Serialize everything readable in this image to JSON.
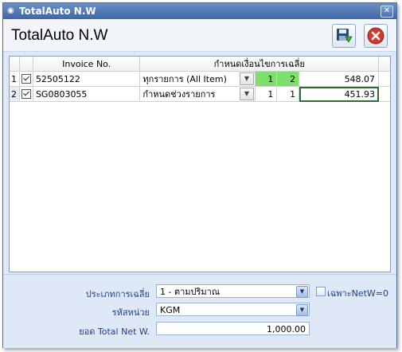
{
  "window": {
    "title": "TotalAuto N.W",
    "close_glyph": "✕"
  },
  "header": {
    "title": "TotalAuto N.W",
    "save_icon": "save-disk-icon",
    "cancel_icon": "cancel-icon"
  },
  "grid": {
    "columns": [
      "Invoice No.",
      "กำหนดเงื่อนไขการเฉลี่ย"
    ],
    "rows": [
      {
        "num": "1",
        "invoice": "52505122",
        "condition": "ทุกรายการ  (All Item)",
        "a": "1",
        "b": "2",
        "amount": "548.07"
      },
      {
        "num": "2",
        "invoice": "SG0803055",
        "condition": "กำหนดช่วงรายการ",
        "a": "1",
        "b": "1",
        "amount": "451.93"
      }
    ]
  },
  "form": {
    "avg_type_label": "ประเภทการเฉลี่ย",
    "avg_type_value": "1 - ตามปริมาณ",
    "unit_label": "รหัสหน่วย",
    "unit_value": "KGM",
    "total_label": "ยอด Total Net W.",
    "total_value": "1,000.00",
    "only_zero_label": "เฉพาะNetW=0"
  },
  "colors": {
    "accent": "#3f67a6",
    "highlight": "#7ee06a"
  }
}
